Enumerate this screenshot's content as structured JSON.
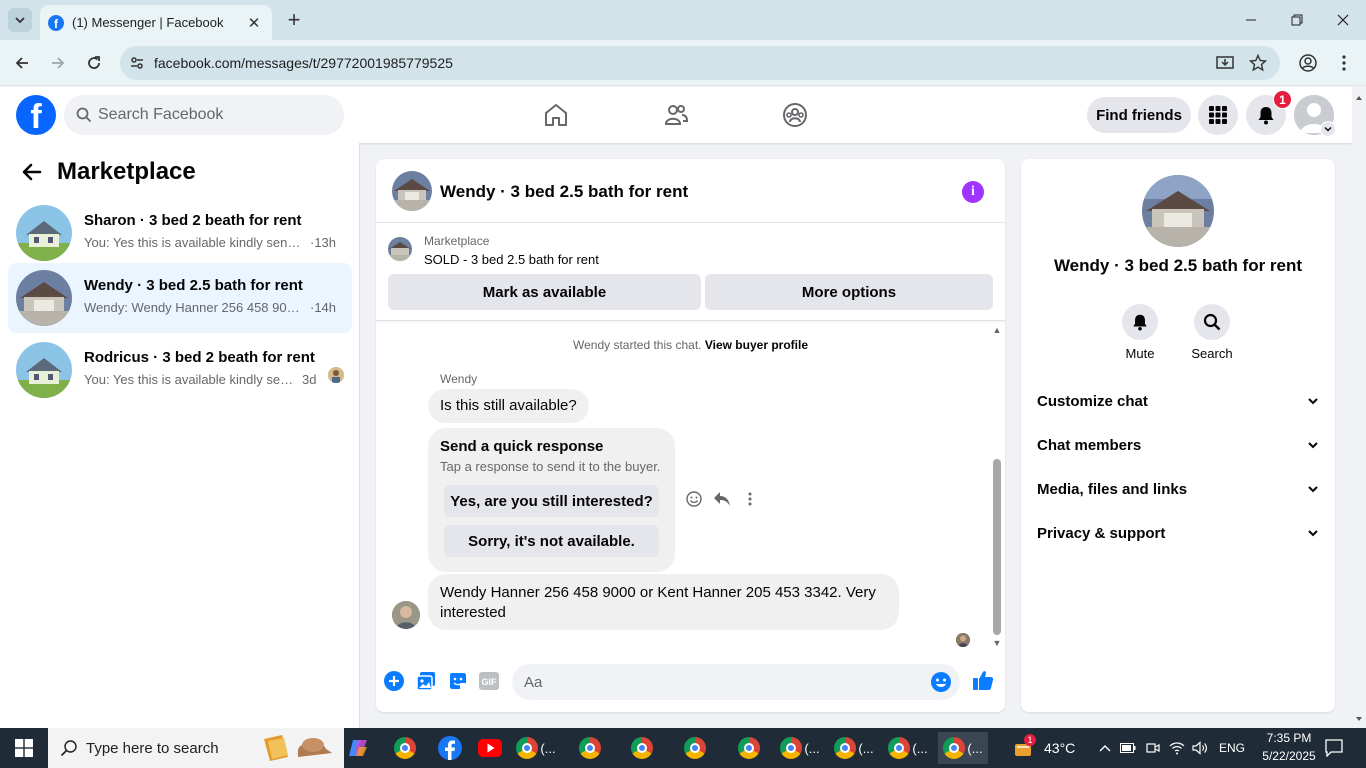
{
  "browser": {
    "tab_title": "(1) Messenger | Facebook",
    "url": "facebook.com/messages/t/29772001985779525"
  },
  "fb_header": {
    "search_placeholder": "Search Facebook",
    "find_friends": "Find friends",
    "notification_count": "1"
  },
  "sidebar": {
    "title": "Marketplace",
    "conversations": [
      {
        "name": "Sharon · 3 bed 2 beath for rent",
        "snippet": "You: Yes this is available kindly send ...",
        "time": "·13h",
        "active": false
      },
      {
        "name": "Wendy · 3 bed 2.5 bath for rent",
        "snippet": "Wendy: Wendy Hanner 256 458 900...",
        "time": "·14h",
        "active": true
      },
      {
        "name": "Rodricus · 3 bed 2 beath for rent",
        "snippet": "You: Yes this is available kindly sen...",
        "time": "3d",
        "active": false
      }
    ]
  },
  "chat": {
    "title": "Wendy · 3 bed 2.5 bath for rent",
    "marketplace_label": "Marketplace",
    "listing_status": "SOLD - 3 bed 2.5 bath for rent",
    "mark_available": "Mark as available",
    "more_options": "More options",
    "started_text": "Wendy started this chat.",
    "view_profile": "View buyer profile",
    "sender_name": "Wendy",
    "message_1": "Is this still available?",
    "quick_response_title": "Send a quick response",
    "quick_response_sub": "Tap a response to send it to the buyer.",
    "quick_option_1": "Yes, are you still interested?",
    "quick_option_2": "Sorry, it's not available.",
    "message_2_line1": "Wendy Hanner 256 458 9000 or Kent Hanner 205 453 3342. Very",
    "message_2_line2": "interested",
    "composer_placeholder": "Aa"
  },
  "info_panel": {
    "name": "Wendy · 3 bed 2.5 bath for rent",
    "mute": "Mute",
    "search": "Search",
    "rows": [
      "Customize chat",
      "Chat members",
      "Media, files and links",
      "Privacy & support"
    ]
  },
  "taskbar": {
    "search_placeholder": "Type here to search",
    "temperature": "43°C",
    "language": "ENG",
    "time": "7:35 PM",
    "date": "5/22/2025",
    "weather_badge": "1",
    "overflow_label": "(..."
  },
  "colors": {
    "fb_blue": "#0866ff",
    "accent_purple": "#a033ff",
    "messenger_blue": "#0a7cff",
    "notification_red": "#e41e3f"
  }
}
